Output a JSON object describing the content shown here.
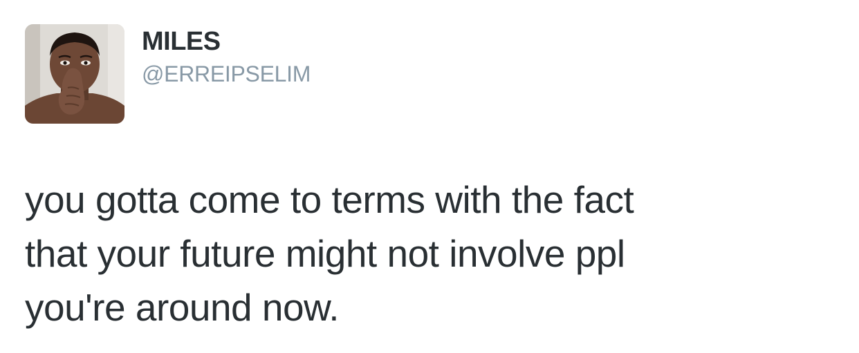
{
  "user": {
    "display_name": "MILES",
    "handle": "@ERREIPSELIM",
    "avatar_icon": "profile-photo"
  },
  "tweet": {
    "lines": [
      "you gotta come to terms with the fact",
      "that your future might not involve ppl",
      "you're around now."
    ]
  },
  "colors": {
    "text": "#292f33",
    "handle": "#8899a6",
    "background": "#ffffff"
  }
}
